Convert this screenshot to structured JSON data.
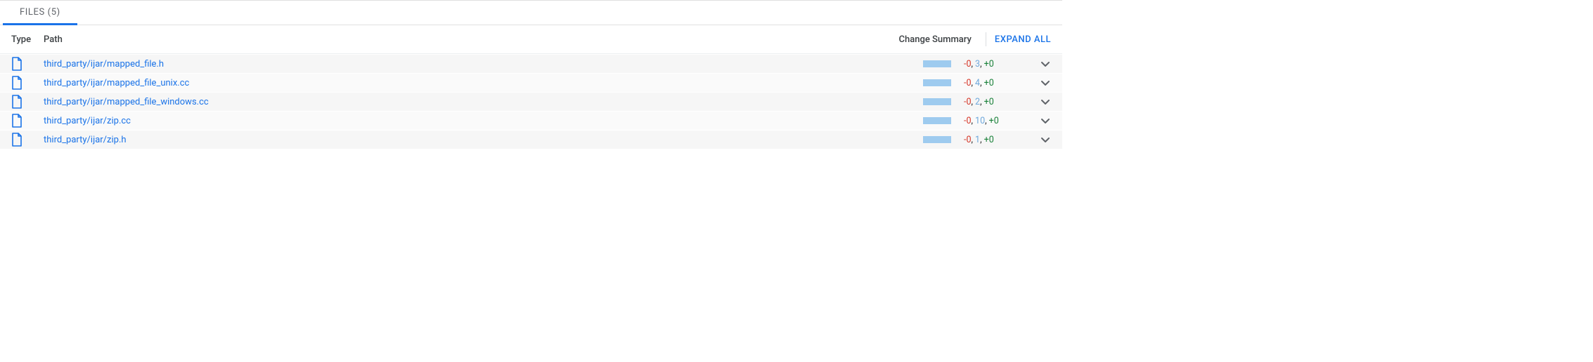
{
  "tab": {
    "label": "FILES",
    "count": 5
  },
  "header": {
    "type": "Type",
    "path": "Path",
    "change_summary": "Change Summary",
    "expand_all": "EXPAND ALL"
  },
  "files": [
    {
      "path": "third_party/ijar/mapped_file.h",
      "deleted": 0,
      "modified": 3,
      "added": 0
    },
    {
      "path": "third_party/ijar/mapped_file_unix.cc",
      "deleted": 0,
      "modified": 4,
      "added": 0
    },
    {
      "path": "third_party/ijar/mapped_file_windows.cc",
      "deleted": 0,
      "modified": 2,
      "added": 0
    },
    {
      "path": "third_party/ijar/zip.cc",
      "deleted": 0,
      "modified": 10,
      "added": 0
    },
    {
      "path": "third_party/ijar/zip.h",
      "deleted": 0,
      "modified": 1,
      "added": 0
    }
  ]
}
